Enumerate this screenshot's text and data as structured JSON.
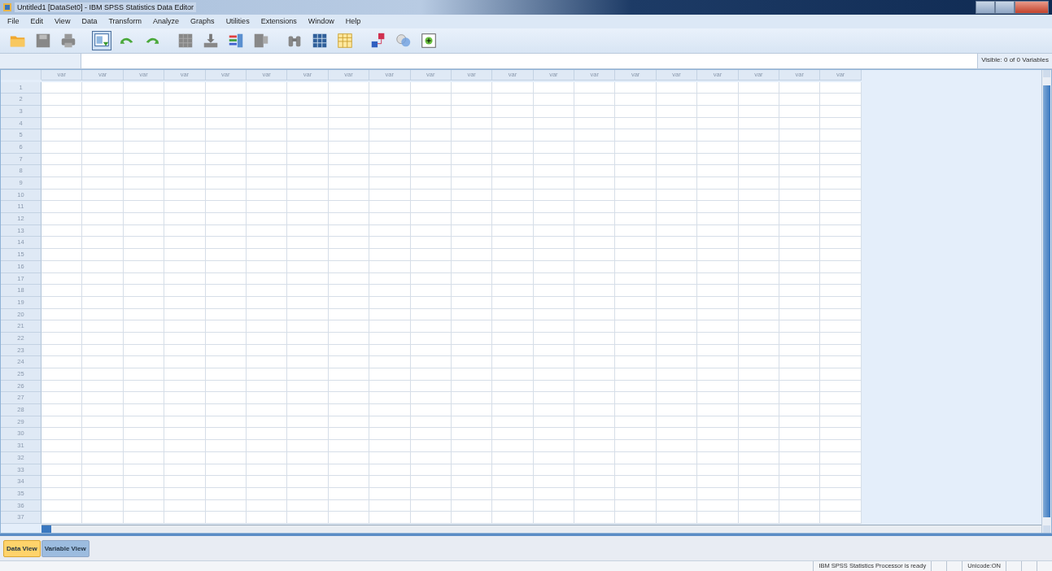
{
  "window": {
    "title": "Untitled1 [DataSet0] - IBM SPSS Statistics Data Editor"
  },
  "menu": [
    "File",
    "Edit",
    "View",
    "Data",
    "Transform",
    "Analyze",
    "Graphs",
    "Utilities",
    "Extensions",
    "Window",
    "Help"
  ],
  "toolbar": [
    {
      "kind": "folder"
    },
    {
      "kind": "disk"
    },
    {
      "kind": "printer"
    },
    {
      "kind": "dialog",
      "selected": true
    },
    {
      "kind": "undo"
    },
    {
      "kind": "redo"
    },
    {
      "kind": "grid"
    },
    {
      "kind": "download"
    },
    {
      "kind": "bars"
    },
    {
      "kind": "panel"
    },
    {
      "kind": "binoculars"
    },
    {
      "kind": "table"
    },
    {
      "kind": "sheet"
    },
    {
      "kind": "labels"
    },
    {
      "kind": "circles"
    },
    {
      "kind": "plus"
    }
  ],
  "cell_bar": {
    "visible_label": "Visible: 0 of 0 Variables"
  },
  "table": {
    "columns": [
      "var",
      "var",
      "var",
      "var",
      "var",
      "var",
      "var",
      "var",
      "var",
      "var",
      "var",
      "var",
      "var",
      "var",
      "var",
      "var",
      "var",
      "var",
      "var",
      "var"
    ],
    "rows": [
      "1",
      "2",
      "3",
      "4",
      "5",
      "6",
      "7",
      "8",
      "9",
      "10",
      "11",
      "12",
      "13",
      "14",
      "15",
      "16",
      "17",
      "18",
      "19",
      "20",
      "21",
      "22",
      "23",
      "24",
      "25",
      "26",
      "27",
      "28",
      "29",
      "30",
      "31",
      "32",
      "33",
      "34",
      "35",
      "36",
      "37"
    ]
  },
  "tabs": [
    {
      "label": "Data View",
      "selected": true
    },
    {
      "label": "Variable View",
      "selected": false
    }
  ],
  "status_bar": {
    "message": "IBM SPSS Statistics Processor is ready",
    "encoding": "Unicode:ON"
  }
}
